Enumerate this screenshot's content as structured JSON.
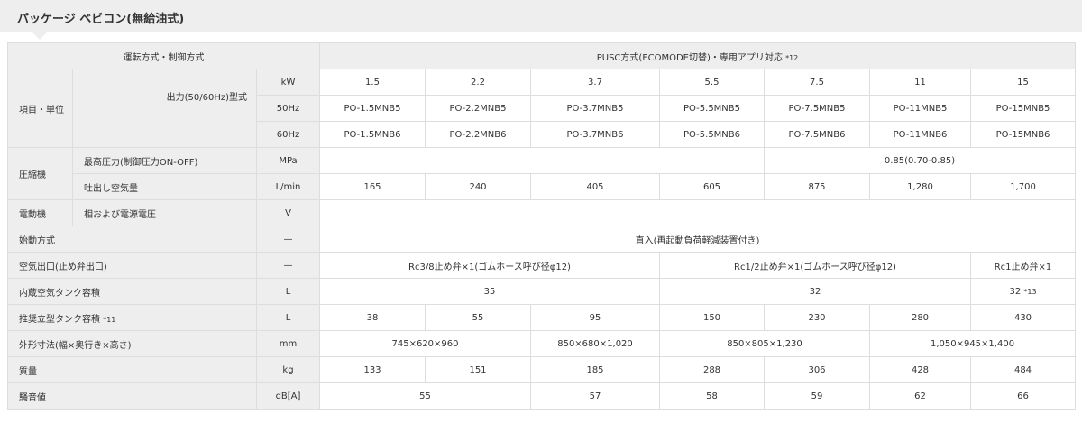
{
  "title": "パッケージ ベビコン(無給油式)",
  "header": {
    "drive_label": "運転方式・制御方式",
    "drive_value": "PUSC方式(ECOMODE切替)・専用アプリ対応",
    "drive_note": "*12",
    "item_label": "項目・単位",
    "output_label": "出力(50/60Hz)型式"
  },
  "units": {
    "kw": "kW",
    "hz50": "50Hz",
    "hz60": "60Hz"
  },
  "kw_values": [
    "1.5",
    "2.2",
    "3.7",
    "5.5",
    "7.5",
    "11",
    "15"
  ],
  "models_50": [
    "PO-1.5MNB5",
    "PO-2.2MNB5",
    "PO-3.7MNB5",
    "PO-5.5MNB5",
    "PO-7.5MNB5",
    "PO-11MNB5",
    "PO-15MNB5"
  ],
  "models_60": [
    "PO-1.5MNB6",
    "PO-2.2MNB6",
    "PO-3.7MNB6",
    "PO-5.5MNB6",
    "PO-7.5MNB6",
    "PO-11MNB6",
    "PO-15MNB6"
  ],
  "compressor": {
    "label": "圧縮機",
    "max_pressure_label": "最高圧力(制御圧力ON-OFF)",
    "max_pressure_unit": "MPa",
    "max_pressure_value": "0.85(0.70-0.85)",
    "air_label": "吐出し空気量",
    "air_unit": "L/min",
    "air_values": [
      "165",
      "240",
      "405",
      "605",
      "875",
      "1,280",
      "1,700"
    ]
  },
  "motor": {
    "label": "電動機",
    "sub_label": "相および電源電圧",
    "unit": "V"
  },
  "start": {
    "label": "始動方式",
    "unit": "—",
    "value": "直入(再起動負荷軽減装置付き)"
  },
  "outlet": {
    "label": "空気出口(止め弁出口)",
    "unit": "—",
    "values": [
      "Rc3/8止め弁×1(ゴムホース呼び径φ12)",
      "Rc1/2止め弁×1(ゴムホース呼び径φ12)",
      "Rc1止め弁×1"
    ]
  },
  "tank": {
    "label": "内蔵空気タンク容積",
    "unit": "L",
    "values": [
      "35",
      "32",
      "32"
    ],
    "last_note": "*13"
  },
  "rec_tank": {
    "label": "推奨立型タンク容積",
    "note": "*11",
    "unit": "L",
    "values": [
      "38",
      "55",
      "95",
      "150",
      "230",
      "280",
      "430"
    ]
  },
  "dimensions": {
    "label": "外形寸法(幅×奥行き×高さ)",
    "unit": "mm",
    "values": [
      "745×620×960",
      "850×680×1,020",
      "850×805×1,230",
      "1,050×945×1,400"
    ]
  },
  "mass": {
    "label": "質量",
    "unit": "kg",
    "values": [
      "133",
      "151",
      "185",
      "288",
      "306",
      "428",
      "484"
    ]
  },
  "noise": {
    "label": "騒音値",
    "unit": "dB[A]",
    "values": [
      "55",
      "57",
      "58",
      "59",
      "62",
      "66"
    ]
  }
}
